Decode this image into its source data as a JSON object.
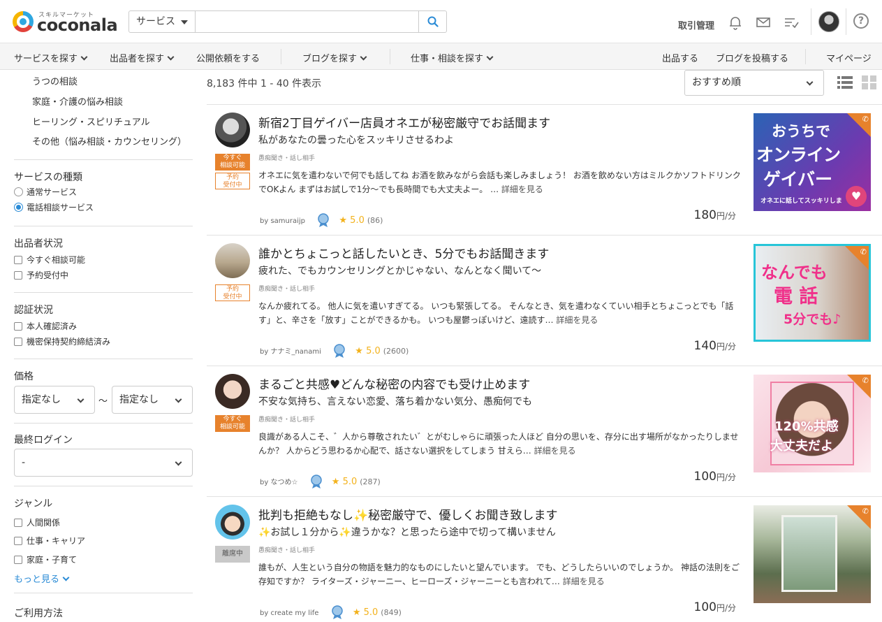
{
  "header": {
    "logo_small": "スキルマーケット",
    "logo_text": "coconala",
    "search_category": "サービス",
    "search_placeholder": "",
    "transaction_link": "取引管理",
    "help_label": "?"
  },
  "nav": {
    "items": [
      "サービスを探す",
      "出品者を探す",
      "公開依頼をする",
      "ブログを探す",
      "仕事・相談を探す"
    ],
    "right_items": [
      "出品する",
      "ブログを投稿する",
      "マイページ"
    ]
  },
  "sidebar": {
    "categories": [
      "うつの相談",
      "家庭・介護の悩み相談",
      "ヒーリング・スピリチュアル",
      "その他（悩み相談・カウンセリング）"
    ],
    "service_type": {
      "heading": "サービスの種類",
      "options": [
        {
          "label": "通常サービス",
          "selected": false
        },
        {
          "label": "電話相談サービス",
          "selected": true
        }
      ]
    },
    "seller_status": {
      "heading": "出品者状況",
      "options": [
        "今すぐ相談可能",
        "予約受付中"
      ]
    },
    "verification": {
      "heading": "認証状況",
      "options": [
        "本人確認済み",
        "機密保持契約締結済み"
      ]
    },
    "price": {
      "heading": "価格",
      "min": "指定なし",
      "separator": "〜",
      "max": "指定なし"
    },
    "last_login": {
      "heading": "最終ログイン",
      "value": "-"
    },
    "genre": {
      "heading": "ジャンル",
      "options": [
        "人間関係",
        "仕事・キャリア",
        "家庭・子育て"
      ],
      "more": "もっと見る"
    },
    "usage_heading": "ご利用方法"
  },
  "main": {
    "result_count": "8,183 件中 1 - 40 件表示",
    "sort": "おすすめ順",
    "listings": [
      {
        "title": "新宿2丁目ゲイバー店員オネエが秘密厳守でお話聞ます",
        "subtitle": "私があなたの曇った心をスッキリさせるわよ",
        "category": "愚痴聞き・話し相手",
        "description": "オネエに気を遣わないで何でも話してね お酒を飲みながら会話も楽しみましょう！ お酒を飲めない方はミルクかソフトドリンクでOKよん まずはお試しで1分〜でも長時間でも大丈夫よー。 … ",
        "more": "詳細を見る",
        "by": "by samuraijp",
        "rating": "★ 5.0",
        "rating_count": "(86)",
        "price": "180",
        "price_unit": "円/分",
        "badges": [
          "今すぐ\n相談可能",
          "予約\n受付中"
        ],
        "thumb_lines": [
          "おうちで",
          "オンライン",
          "ゲイバー",
          "オネエに話してスッキリしま"
        ]
      },
      {
        "title": "誰かとちょこっと話したいとき、5分でもお話聞きます",
        "subtitle": "疲れた、でもカウンセリングとかじゃない、なんとなく聞いて〜",
        "category": "愚痴聞き・話し相手",
        "description": "なんか疲れてる。 他人に気を遣いすぎてる。 いつも緊張してる。 そんなとき、気を遣わなくていい相手とちょこっとでも「話す」と、辛さを「放す」ことができるかも。 いつも屋鬱っぽいけど、遠読す… ",
        "more": "詳細を見る",
        "by": "by ナナミ_nanami",
        "rating": "★ 5.0",
        "rating_count": "(2600)",
        "price": "140",
        "price_unit": "円/分",
        "badges": [
          "予約\n受付中"
        ],
        "thumb_lines": [
          "なんでも",
          "電 話",
          "5分でも♪"
        ]
      },
      {
        "title": "まるごと共感♥どんな秘密の内容でも受け止めます",
        "subtitle": "不安な気持ち、言えない恋愛、落ち着かない気分、愚痴何でも",
        "category": "愚痴聞き・話し相手",
        "description": "良識がある人こそ、゛人から尊敬されたい゛とがむしゃらに頑張った人ほど 自分の思いを、存分に出す場所がなかったりしませんか？ 人からどう思わるか心配で、話さない選択をしてしまう 甘えら… ",
        "more": "詳細を見る",
        "by": "by なつめ☆",
        "rating": "★ 5.0",
        "rating_count": "(287)",
        "price": "100",
        "price_unit": "円/分",
        "badges": [
          "今すぐ\n相談可能"
        ],
        "thumb_lines": [
          "120%共感",
          "大丈夫だよ"
        ]
      },
      {
        "title": "批判も拒絶もなし✨秘密厳守で、優しくお聞き致します",
        "subtitle": "✨お試し１分から✨違うかな？と思ったら途中で切って構いません",
        "category": "愚痴聞き・話し相手",
        "description": "誰もが、人生という自分の物語を魅力的なものにしたいと望んでいます。 でも、どうしたらいいのでしょうか。 神話の法則をご存知ですか？ ライターズ・ジャーニー、ヒーローズ・ジャーニーとも言われて… ",
        "more": "詳細を見る",
        "by": "by create my life",
        "rating": "★ 5.0",
        "rating_count": "(849)",
        "price": "100",
        "price_unit": "円/分",
        "badges": [
          "離席中"
        ],
        "thumb_lines": []
      }
    ]
  },
  "colors": {
    "accent_orange": "#e7822c",
    "link_blue": "#2a8bd6",
    "star": "#f3b21c"
  }
}
